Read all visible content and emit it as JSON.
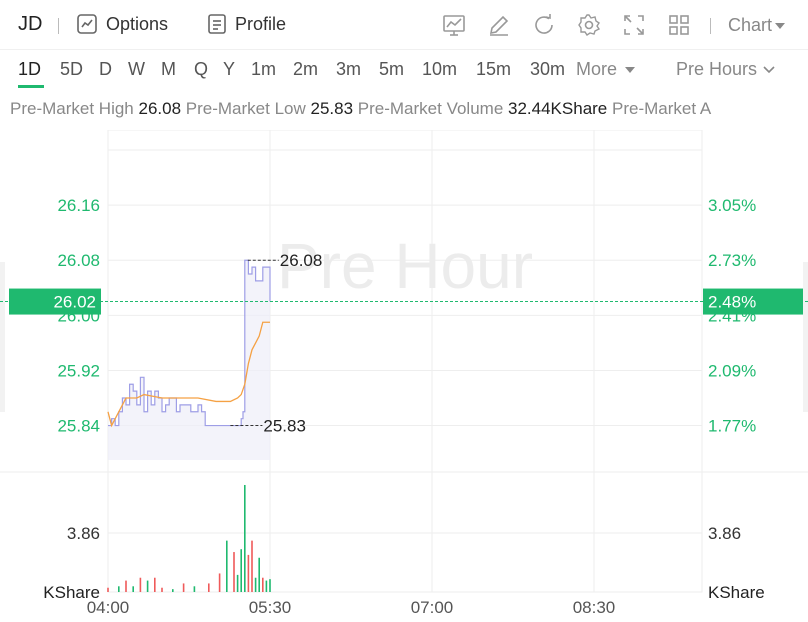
{
  "toolbar": {
    "ticker": "JD",
    "options_label": "Options",
    "profile_label": "Profile",
    "chart_label": "Chart",
    "icons": [
      "chart-icon",
      "edit-icon",
      "refresh-icon",
      "settings-icon",
      "fullscreen-icon",
      "layout-grid-icon"
    ]
  },
  "periods": {
    "items": [
      "1D",
      "5D",
      "D",
      "W",
      "M",
      "Q",
      "Y",
      "1m",
      "2m",
      "3m",
      "5m",
      "10m",
      "15m",
      "30m"
    ],
    "active": "1D",
    "more_label": "More",
    "session_label": "Pre Hours"
  },
  "stats": {
    "high_label": "Pre-Market High",
    "high_value": "26.08",
    "low_label": "Pre-Market Low",
    "low_value": "25.83",
    "volume_label": "Pre-Market Volume",
    "volume_value": "32.44KShare",
    "extra_label": "Pre-Market A"
  },
  "chart": {
    "watermark": "Pre Hour",
    "current_price_label": "26.02",
    "current_pct_label": "2.48%",
    "high_marker": "26.08",
    "low_marker": "25.83",
    "volume_left_tick": "3.86",
    "volume_right_tick": "3.86",
    "volume_unit_left": "KShare",
    "volume_unit_right": "KShare",
    "colors": {
      "up": "#1fb96f",
      "down": "#ef5a5a",
      "price_line": "#9e9ee6",
      "avg_line": "#f5a144"
    }
  },
  "chart_data": {
    "type": "line",
    "price_axis": {
      "ticks": [
        "26.16",
        "26.08",
        "26.00",
        "25.92",
        "25.84"
      ],
      "values": [
        26.16,
        26.08,
        26.0,
        25.92,
        25.84
      ],
      "range": [
        25.79,
        26.24
      ]
    },
    "pct_axis": {
      "ticks": [
        "3.05%",
        "2.73%",
        "2.41%",
        "2.09%",
        "1.77%"
      ]
    },
    "time_axis": {
      "ticks": [
        "04:00",
        "05:30",
        "07:00",
        "08:30"
      ]
    },
    "series": [
      {
        "name": "price",
        "x": [
          "04:00",
          "04:02",
          "04:04",
          "04:06",
          "04:08",
          "04:10",
          "04:12",
          "04:14",
          "04:16",
          "04:18",
          "04:20",
          "04:22",
          "04:24",
          "04:26",
          "04:28",
          "04:30",
          "04:32",
          "04:34",
          "04:36",
          "04:38",
          "04:40",
          "04:42",
          "04:44",
          "04:46",
          "04:48",
          "04:50",
          "04:52",
          "04:54",
          "04:56",
          "05:00",
          "05:04",
          "05:08",
          "05:10",
          "05:12",
          "05:14",
          "05:15",
          "05:16",
          "05:18",
          "05:20",
          "05:22",
          "05:24",
          "05:26",
          "05:28",
          "05:30"
        ],
        "y": [
          25.84,
          25.85,
          25.84,
          25.86,
          25.88,
          25.87,
          25.9,
          25.89,
          25.87,
          25.91,
          25.86,
          25.89,
          25.87,
          25.89,
          25.88,
          25.86,
          25.87,
          25.88,
          25.88,
          25.86,
          25.87,
          25.87,
          25.87,
          25.86,
          25.86,
          25.87,
          25.86,
          25.84,
          25.84,
          25.84,
          25.84,
          25.84,
          25.84,
          25.84,
          25.85,
          25.86,
          26.08,
          26.06,
          26.07,
          26.05,
          26.05,
          26.07,
          26.07,
          26.02
        ]
      },
      {
        "name": "average",
        "x": [
          "04:00",
          "04:02",
          "04:04",
          "04:06",
          "04:08",
          "04:10",
          "04:12",
          "04:16",
          "04:20",
          "04:30",
          "04:40",
          "04:50",
          "05:00",
          "05:08",
          "05:12",
          "05:14",
          "05:16",
          "05:18",
          "05:20",
          "05:22",
          "05:24",
          "05:26",
          "05:28",
          "05:30"
        ],
        "y": [
          25.86,
          25.84,
          25.85,
          25.86,
          25.87,
          25.88,
          25.88,
          25.88,
          25.885,
          25.88,
          25.88,
          25.88,
          25.875,
          25.875,
          25.88,
          25.885,
          25.9,
          25.93,
          25.95,
          25.96,
          25.97,
          25.99,
          25.99,
          25.99
        ]
      }
    ],
    "volume": {
      "x": [
        "04:00",
        "04:06",
        "04:10",
        "04:14",
        "04:18",
        "04:22",
        "04:26",
        "04:30",
        "04:36",
        "04:42",
        "04:48",
        "04:56",
        "05:02",
        "05:06",
        "05:10",
        "05:12",
        "05:14",
        "05:16",
        "05:18",
        "05:20",
        "05:22",
        "05:24",
        "05:26",
        "05:28",
        "05:30"
      ],
      "values": [
        0.3,
        0.4,
        0.8,
        0.4,
        1.0,
        0.8,
        1.0,
        0.3,
        0.2,
        0.6,
        0.4,
        0.6,
        1.3,
        3.6,
        2.8,
        1.2,
        3.0,
        7.5,
        2.6,
        3.6,
        1.0,
        2.4,
        1.0,
        0.8,
        0.9
      ],
      "direction": [
        "down",
        "up",
        "down",
        "up",
        "down",
        "up",
        "down",
        "down",
        "up",
        "down",
        "up",
        "down",
        "down",
        "up",
        "down",
        "up",
        "up",
        "up",
        "down",
        "down",
        "up",
        "up",
        "down",
        "up",
        "up"
      ]
    }
  }
}
